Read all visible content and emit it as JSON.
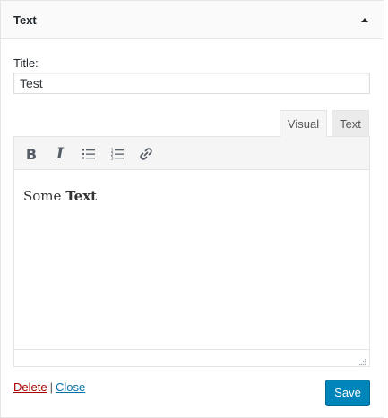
{
  "widget": {
    "title": "Text",
    "toggle_icon": "triangle-up-icon"
  },
  "form": {
    "title_label": "Title:",
    "title_value": "Test"
  },
  "editor": {
    "tabs": [
      {
        "label": "Visual",
        "active": true
      },
      {
        "label": "Text",
        "active": false
      }
    ],
    "toolbar": [
      "bold-icon",
      "italic-icon",
      "bullet-list-icon",
      "numbered-list-icon",
      "link-icon"
    ],
    "content_plain": "Some",
    "content_bold": "Text"
  },
  "actions": {
    "delete_label": "Delete",
    "separator": "|",
    "close_label": "Close",
    "save_label": "Save"
  },
  "colors": {
    "primary_button": "#0085ba",
    "delete_link": "#aa0000",
    "close_link": "#0073aa"
  }
}
